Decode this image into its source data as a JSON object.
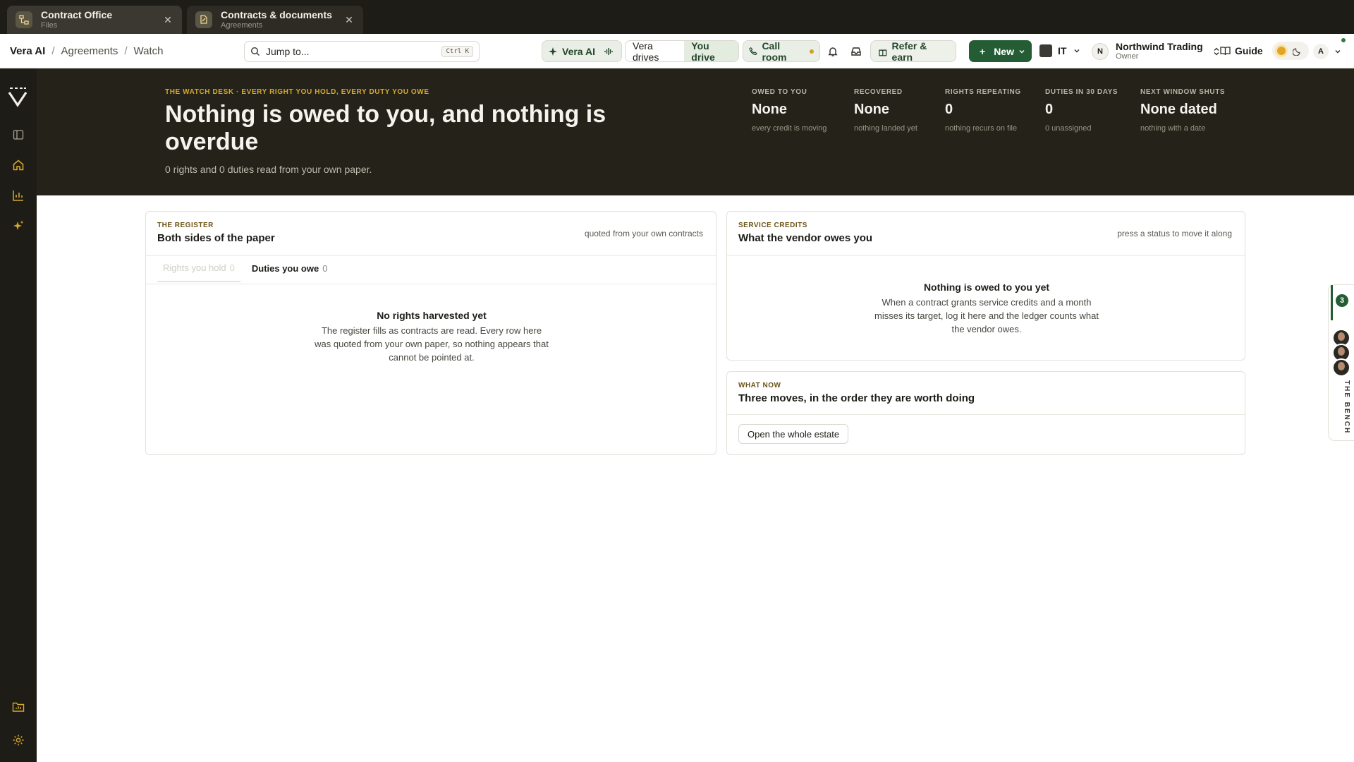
{
  "colors": {
    "chrome_dark": "#1e1c16",
    "hero_bg": "#242219",
    "accent_green": "#245c33",
    "kicker_gold": "#d5a92f"
  },
  "browser_tabs": [
    {
      "title": "Contract Office",
      "subtitle": "Files",
      "icon": "sitemap-icon"
    },
    {
      "title": "Contracts & documents",
      "subtitle": "Agreements",
      "icon": "document-edit-icon"
    }
  ],
  "breadcrumb": [
    "Vera AI",
    "Agreements",
    "Watch"
  ],
  "search": {
    "placeholder": "Jump to...",
    "shortcut": "Ctrl K"
  },
  "header": {
    "vera_ai": "Vera AI",
    "mode_ai": "Vera drives",
    "mode_user": "You drive",
    "call_room": "Call room",
    "refer": "Refer & earn",
    "new": "New",
    "language": "IT",
    "org_initial": "N",
    "org_name": "Northwind Trading",
    "org_role": "Owner",
    "guide": "Guide",
    "user_initial": "A"
  },
  "hero": {
    "kicker": "THE WATCH DESK · EVERY RIGHT YOU HOLD, EVERY DUTY YOU OWE",
    "title": "Nothing is owed to you, and nothing is overdue",
    "subtitle": "0 rights and 0 duties read from your own paper.",
    "stats": [
      {
        "label": "OWED TO YOU",
        "value": "None",
        "note": "every credit is moving"
      },
      {
        "label": "RECOVERED",
        "value": "None",
        "note": "nothing landed yet"
      },
      {
        "label": "RIGHTS REPEATING",
        "value": "0",
        "note": "nothing recurs on file"
      },
      {
        "label": "DUTIES IN 30 DAYS",
        "value": "0",
        "note": "0 unassigned"
      },
      {
        "label": "NEXT WINDOW SHUTS",
        "value": "None dated",
        "note": "nothing with a date"
      }
    ]
  },
  "register": {
    "kicker": "THE REGISTER",
    "title": "Both sides of the paper",
    "note": "quoted from your own contracts",
    "tabs": [
      {
        "label": "Rights you hold",
        "count": "0"
      },
      {
        "label": "Duties you owe",
        "count": "0"
      }
    ],
    "empty_title": "No rights harvested yet",
    "empty_text": "The register fills as contracts are read. Every row here was quoted from your own paper, so nothing appears that cannot be pointed at."
  },
  "credits": {
    "kicker": "SERVICE CREDITS",
    "title": "What the vendor owes you",
    "note": "press a status to move it along",
    "empty_title": "Nothing is owed to you yet",
    "empty_text": "When a contract grants service credits and a month misses its target, log it here and the ledger counts what the vendor owes."
  },
  "what_now": {
    "kicker": "WHAT NOW",
    "title": "Three moves, in the order they are worth doing",
    "button": "Open the whole estate"
  },
  "bench": {
    "badge": "3",
    "label": "THE BENCH"
  }
}
